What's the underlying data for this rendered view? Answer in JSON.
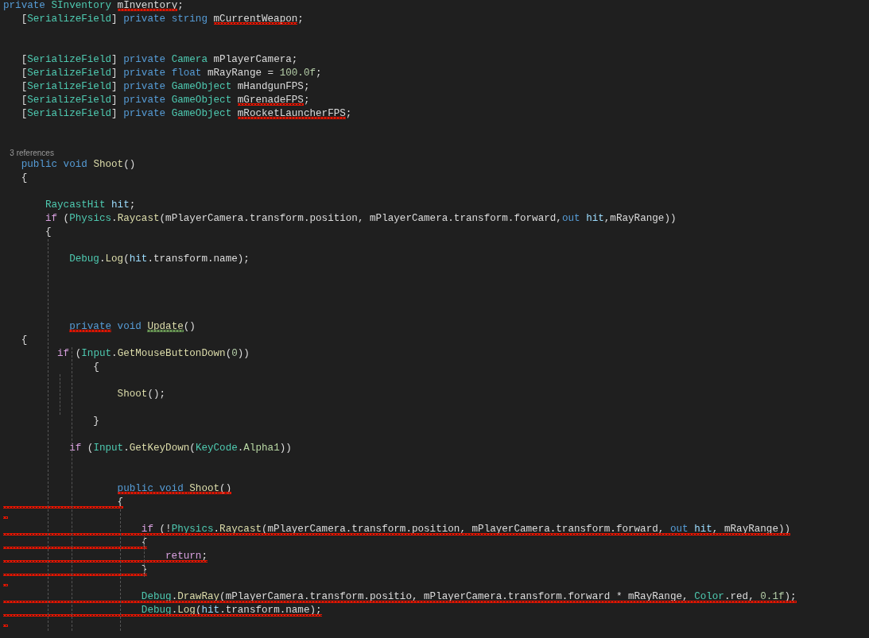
{
  "editor": {
    "lines": [
      {
        "tokens": [
          {
            "text": "private ",
            "kind": "kw"
          },
          {
            "text": "SInventory ",
            "kind": "type"
          },
          {
            "text": "mInventory",
            "error": true
          },
          {
            "text": ";"
          }
        ]
      },
      {
        "tokens": [
          {
            "text": "   ["
          },
          {
            "text": "SerializeField",
            "kind": "type"
          },
          {
            "text": "] "
          },
          {
            "text": "private ",
            "kind": "kw"
          },
          {
            "text": "string ",
            "kind": "kw"
          },
          {
            "text": "mCurrentWeapon",
            "error": true
          },
          {
            "text": ";"
          }
        ]
      },
      {
        "kind": "blank"
      },
      {
        "kind": "blank"
      },
      {
        "tokens": [
          {
            "text": "   ["
          },
          {
            "text": "SerializeField",
            "kind": "type"
          },
          {
            "text": "] "
          },
          {
            "text": "private ",
            "kind": "kw"
          },
          {
            "text": "Camera",
            "kind": "type"
          },
          {
            "text": " mPlayerCamera;"
          }
        ]
      },
      {
        "tokens": [
          {
            "text": "   ["
          },
          {
            "text": "SerializeField",
            "kind": "type"
          },
          {
            "text": "] "
          },
          {
            "text": "private ",
            "kind": "kw"
          },
          {
            "text": "float",
            "kind": "kw"
          },
          {
            "text": " mRayRange = "
          },
          {
            "text": "100.0f",
            "kind": "num"
          },
          {
            "text": ";"
          }
        ]
      },
      {
        "tokens": [
          {
            "text": "   ["
          },
          {
            "text": "SerializeField",
            "kind": "type"
          },
          {
            "text": "] "
          },
          {
            "text": "private ",
            "kind": "kw"
          },
          {
            "text": "GameObject",
            "kind": "type"
          },
          {
            "text": " mHandgunFPS;"
          }
        ]
      },
      {
        "tokens": [
          {
            "text": "   ["
          },
          {
            "text": "SerializeField",
            "kind": "type"
          },
          {
            "text": "] "
          },
          {
            "text": "private ",
            "kind": "kw"
          },
          {
            "text": "GameObject ",
            "kind": "type"
          },
          {
            "text": "mGrenadeFPS",
            "error": true
          },
          {
            "text": ";"
          }
        ]
      },
      {
        "tokens": [
          {
            "text": "   ["
          },
          {
            "text": "SerializeField",
            "kind": "type"
          },
          {
            "text": "] "
          },
          {
            "text": "private ",
            "kind": "kw"
          },
          {
            "text": "GameObject ",
            "kind": "type"
          },
          {
            "text": "mRocketLauncherFPS",
            "error": true
          },
          {
            "text": ";"
          }
        ]
      },
      {
        "kind": "blank"
      },
      {
        "kind": "blank"
      },
      {
        "kind": "codelens",
        "tokens": [
          {
            "text": "   3 references"
          }
        ]
      },
      {
        "tokens": [
          {
            "text": "   public ",
            "kind": "kw"
          },
          {
            "text": "void ",
            "kind": "kw"
          },
          {
            "text": "Shoot",
            "kind": "method"
          },
          {
            "text": "()"
          }
        ]
      },
      {
        "tokens": [
          {
            "text": "   {"
          }
        ]
      },
      {
        "kind": "blank"
      },
      {
        "tokens": [
          {
            "text": "       RaycastHit ",
            "kind": "type"
          },
          {
            "text": "hit",
            "kind": "local"
          },
          {
            "text": ";"
          }
        ]
      },
      {
        "tokens": [
          {
            "text": "       if",
            "kind": "ctrl"
          },
          {
            "text": " ("
          },
          {
            "text": "Physics",
            "kind": "type"
          },
          {
            "text": "."
          },
          {
            "text": "Raycast",
            "kind": "method"
          },
          {
            "text": "(mPlayerCamera.transform.position, mPlayerCamera.transform.forward,"
          },
          {
            "text": "out ",
            "kind": "kw"
          },
          {
            "text": "hit",
            "kind": "local"
          },
          {
            "text": ",mRayRange))"
          }
        ]
      },
      {
        "tokens": [
          {
            "text": "       {"
          }
        ]
      },
      {
        "kind": "blank"
      },
      {
        "tokens": [
          {
            "text": "           Debug",
            "kind": "type"
          },
          {
            "text": "."
          },
          {
            "text": "Log",
            "kind": "method"
          },
          {
            "text": "("
          },
          {
            "text": "hit",
            "kind": "local"
          },
          {
            "text": ".transform.name);"
          }
        ]
      },
      {
        "kind": "blank"
      },
      {
        "kind": "blank"
      },
      {
        "kind": "blank"
      },
      {
        "kind": "blank"
      },
      {
        "tokens": [
          {
            "text": "           private",
            "kind": "kw",
            "error": true
          },
          {
            "text": " void ",
            "kind": "kw"
          },
          {
            "text": "Update",
            "kind": "method",
            "warning": true
          },
          {
            "text": "()"
          }
        ]
      },
      {
        "tokens": [
          {
            "text": "   {"
          }
        ]
      },
      {
        "tokens": [
          {
            "text": "         if",
            "kind": "ctrl"
          },
          {
            "text": " ("
          },
          {
            "text": "Input",
            "kind": "type"
          },
          {
            "text": "."
          },
          {
            "text": "GetMouseButtonDown",
            "kind": "method"
          },
          {
            "text": "("
          },
          {
            "text": "0",
            "kind": "num"
          },
          {
            "text": "))"
          }
        ]
      },
      {
        "tokens": [
          {
            "text": "               {"
          }
        ]
      },
      {
        "kind": "blank"
      },
      {
        "tokens": [
          {
            "text": "                   Shoot",
            "kind": "method"
          },
          {
            "text": "();"
          }
        ]
      },
      {
        "kind": "blank"
      },
      {
        "tokens": [
          {
            "text": "               }"
          }
        ]
      },
      {
        "kind": "blank"
      },
      {
        "tokens": [
          {
            "text": "           if",
            "kind": "ctrl"
          },
          {
            "text": " ("
          },
          {
            "text": "Input",
            "kind": "type"
          },
          {
            "text": "."
          },
          {
            "text": "GetKeyDown",
            "kind": "method"
          },
          {
            "text": "("
          },
          {
            "text": "KeyCode",
            "kind": "type"
          },
          {
            "text": "."
          },
          {
            "text": "Alpha1",
            "kind": "param"
          },
          {
            "text": "))"
          }
        ]
      },
      {
        "kind": "blank"
      },
      {
        "kind": "blank"
      },
      {
        "tokens": [
          {
            "text": "                   public void ",
            "kind": "kw",
            "error": true
          },
          {
            "text": "Shoot",
            "kind": "method",
            "error": true
          },
          {
            "text": "()",
            "error": true
          }
        ]
      },
      {
        "error": true,
        "tokens": [
          {
            "text": "                   {"
          }
        ]
      },
      {
        "kind": "blank",
        "error": true
      },
      {
        "error": true,
        "tokens": [
          {
            "text": "                       if",
            "kind": "ctrl"
          },
          {
            "text": " (!"
          },
          {
            "text": "Physics",
            "kind": "type"
          },
          {
            "text": "."
          },
          {
            "text": "Raycast",
            "kind": "method"
          },
          {
            "text": "(mPlayerCamera.transform.position, mPlayerCamera.transform.forward, "
          },
          {
            "text": "out ",
            "kind": "kw"
          },
          {
            "text": "hit",
            "kind": "local"
          },
          {
            "text": ", mRayRange))"
          }
        ]
      },
      {
        "error": true,
        "tokens": [
          {
            "text": "                       {"
          }
        ]
      },
      {
        "error": true,
        "tokens": [
          {
            "text": "                           return",
            "kind": "ctrl"
          },
          {
            "text": ";"
          }
        ]
      },
      {
        "error": true,
        "tokens": [
          {
            "text": "                       }"
          }
        ]
      },
      {
        "kind": "blank",
        "error": true
      },
      {
        "error": true,
        "tokens": [
          {
            "text": "                       Debug",
            "kind": "type"
          },
          {
            "text": "."
          },
          {
            "text": "DrawRay",
            "kind": "method"
          },
          {
            "text": "(mPlayerCamera.transform.positio, mPlayerCamera.transform.forward * mRayRange, "
          },
          {
            "text": "Color",
            "kind": "type"
          },
          {
            "text": ".red, "
          },
          {
            "text": "0.1f",
            "kind": "num"
          },
          {
            "text": ");"
          }
        ]
      },
      {
        "error": true,
        "tokens": [
          {
            "text": "                       Debug",
            "kind": "type"
          },
          {
            "text": "."
          },
          {
            "text": "Log",
            "kind": "method"
          },
          {
            "text": "("
          },
          {
            "text": "hit",
            "kind": "local"
          },
          {
            "text": ".transform.name);"
          }
        ]
      },
      {
        "kind": "blank",
        "error": true
      }
    ]
  }
}
